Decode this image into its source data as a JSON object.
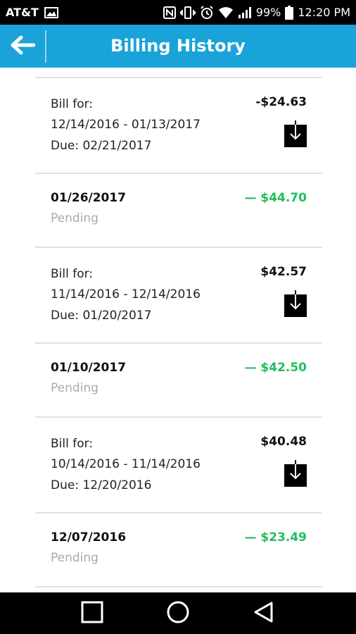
{
  "status_bar": {
    "carrier": "AT&T",
    "battery": "99%",
    "time": "12:20 PM"
  },
  "header": {
    "title": "Billing History",
    "back_icon": "arrow-left-icon"
  },
  "colors": {
    "app_bar": "#1aa3d8",
    "pending_amount": "#1fbf5a",
    "pending_label": "#a9a9a9"
  },
  "entries": [
    {
      "type": "bill",
      "line1": "Bill for:",
      "line2": "12/14/2016 - 01/13/2017",
      "line3": "Due: 02/21/2017",
      "amount": "-$24.63",
      "icon": "download-icon"
    },
    {
      "type": "payment",
      "date": "01/26/2017",
      "status": "Pending",
      "amount": "— $44.70"
    },
    {
      "type": "bill",
      "line1": "Bill for:",
      "line2": "11/14/2016 - 12/14/2016",
      "line3": "Due: 01/20/2017",
      "amount": "$42.57",
      "icon": "download-icon"
    },
    {
      "type": "payment",
      "date": "01/10/2017",
      "status": "Pending",
      "amount": "— $42.50"
    },
    {
      "type": "bill",
      "line1": "Bill for:",
      "line2": "10/14/2016 - 11/14/2016",
      "line3": "Due: 12/20/2016",
      "amount": "$40.48",
      "icon": "download-icon"
    },
    {
      "type": "payment",
      "date": "12/07/2016",
      "status": "Pending",
      "amount": "— $23.49"
    }
  ],
  "nav_bar": {
    "recents_icon": "square-icon",
    "home_icon": "circle-icon",
    "back_icon": "triangle-back-icon"
  }
}
